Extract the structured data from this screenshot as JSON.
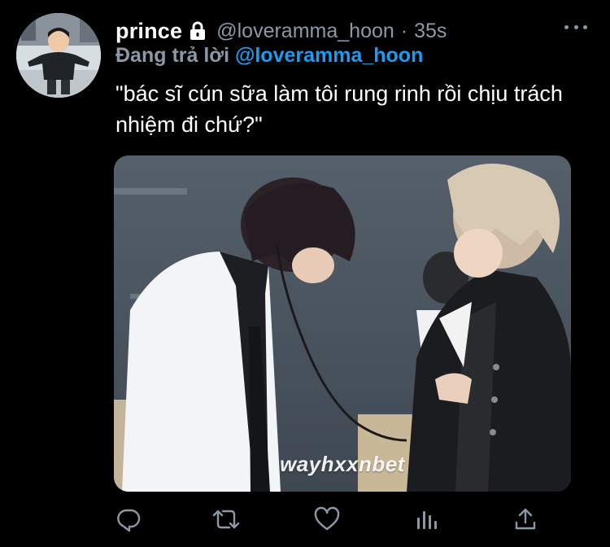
{
  "tweet": {
    "author_name": "prince",
    "author_handle": "@loveramma_hoon",
    "separator": "·",
    "time": "35s",
    "reply_prefix": "Đang trả lời",
    "reply_to": "@loveramma_hoon",
    "text": "\"bác sĩ cún sữa làm tôi rung rinh rồi chịu trách nhiệm đi chứ?\"",
    "media_watermark": "wayhxxnbet",
    "protected_icon": "lock-icon",
    "more_icon": "more-horizontal-icon"
  },
  "actions": [
    {
      "name": "reply",
      "icon": "reply-icon"
    },
    {
      "name": "retweet",
      "icon": "retweet-icon"
    },
    {
      "name": "like",
      "icon": "heart-icon"
    },
    {
      "name": "analytics",
      "icon": "analytics-icon"
    },
    {
      "name": "share",
      "icon": "share-icon"
    }
  ],
  "colors": {
    "background": "#000000",
    "primary_text": "#ffffff",
    "secondary_text": "#8b98a5",
    "accent": "#1d9bf0"
  }
}
